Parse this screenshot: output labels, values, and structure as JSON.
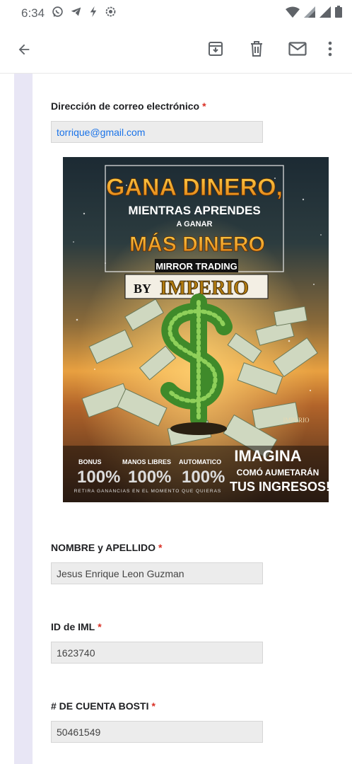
{
  "status_bar": {
    "time": "6:34",
    "colors": {
      "icon": "#5f6368"
    }
  },
  "app_bar": {
    "icons": [
      "back-arrow-icon",
      "archive-icon",
      "delete-icon",
      "mail-icon",
      "more-vert-icon"
    ]
  },
  "form": {
    "fields": [
      {
        "label": "Dirección de correo electrónico",
        "required_mark": "*",
        "value": "torrique@gmail.com"
      },
      {
        "label": "NOMBRE y APELLIDO",
        "required_mark": "*",
        "value": "Jesus Enrique Leon Guzman"
      },
      {
        "label": "ID de IML",
        "required_mark": "*",
        "value": "1623740"
      },
      {
        "label": "# DE CUENTA BOSTI",
        "required_mark": "*",
        "value": "50461549"
      }
    ]
  },
  "poster": {
    "title_line1": "GANA DINERO,",
    "title_line2": "MIENTRAS APRENDES",
    "title_line3": "A GANAR",
    "title_line4": "MÁS DINERO",
    "banner": "MIRROR TRADING",
    "brand_by": "BY",
    "brand": "IMPERIO",
    "small_logo": "IMPERIO",
    "stats": [
      {
        "label": "BONUS",
        "value": "100%"
      },
      {
        "label": "MANOS LIBRES",
        "value": "100%"
      },
      {
        "label": "AUTOMATICO",
        "value": "100%"
      }
    ],
    "footer": "RETIRA GANANCIAS EN EL MOMENTO QUE QUIERAS",
    "cta_line1": "IMAGINA",
    "cta_line2": "COMÓ AUMETARÁN",
    "cta_line3": "TUS INGRESOS!!"
  }
}
